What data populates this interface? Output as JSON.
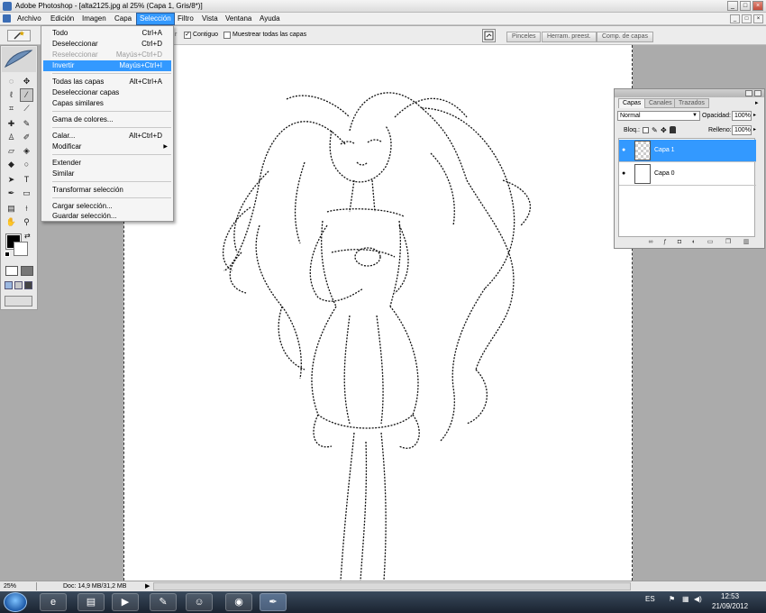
{
  "window": {
    "title": "Adobe Photoshop - [alta2125.jpg al 25% (Capa 1, Gris/8*)]",
    "controls": [
      "_",
      "□",
      "×"
    ]
  },
  "menubar": {
    "items": [
      "Archivo",
      "Edición",
      "Imagen",
      "Capa",
      "Selección",
      "Filtro",
      "Vista",
      "Ventana",
      "Ayuda"
    ],
    "open_item": "Selección"
  },
  "doc_controls": [
    "_",
    "□",
    "×"
  ],
  "options": {
    "tool_letter": "r",
    "contiguous_label": "Contiguo",
    "contiguous_checked": "✓",
    "sample_all_label": "Muestrear todas las capas",
    "palette_tabs": [
      "Pinceles",
      "Herram. preest.",
      "Comp. de capas"
    ]
  },
  "selection_menu": {
    "items": [
      {
        "label": "Todo",
        "shortcut": "Ctrl+A"
      },
      {
        "label": "Deseleccionar",
        "shortcut": "Ctrl+D"
      },
      {
        "label": "Reseleccionar",
        "shortcut": "Mayús+Ctrl+D"
      },
      {
        "label": "Invertir",
        "shortcut": "Mayús+Ctrl+I"
      },
      {
        "label": "Todas las capas",
        "shortcut": "Alt+Ctrl+A"
      },
      {
        "label": "Deseleccionar capas",
        "shortcut": ""
      },
      {
        "label": "Capas similares",
        "shortcut": ""
      },
      {
        "label": "Gama de colores...",
        "shortcut": ""
      },
      {
        "label": "Calar...",
        "shortcut": "Alt+Ctrl+D"
      },
      {
        "label": "Modificar",
        "shortcut": ""
      },
      {
        "label": "Extender",
        "shortcut": ""
      },
      {
        "label": "Similar",
        "shortcut": ""
      },
      {
        "label": "Transformar selección",
        "shortcut": ""
      },
      {
        "label": "Cargar selección...",
        "shortcut": ""
      },
      {
        "label": "Guardar selección...",
        "shortcut": ""
      }
    ],
    "disabled": [
      "Reseleccionar"
    ],
    "highlighted": "Invertir",
    "submenu_arrow": "▶"
  },
  "layers_panel": {
    "tabs": [
      "Capas",
      "Canales",
      "Trazados"
    ],
    "active_tab": "Capas",
    "blend_mode": "Normal",
    "opacity_label": "Opacidad:",
    "opacity_value": "100%",
    "lock_label": "Bloq.:",
    "fill_label": "Relleno:",
    "fill_value": "100%",
    "layers": [
      {
        "name": "Capa 1",
        "selected": true
      },
      {
        "name": "Capa 0",
        "selected": false
      }
    ],
    "eye_glyph": "●",
    "footer_icons": [
      "link-icon",
      "fx-icon",
      "mask-icon",
      "adjustment-icon",
      "group-icon",
      "new-layer-icon",
      "trash-icon"
    ]
  },
  "status": {
    "zoom": "25%",
    "doc_info": "Doc: 14,9 MB/31,2 MB",
    "arrow": "▶"
  },
  "taskbar": {
    "language": "ES",
    "time": "12:53",
    "date": "21/09/2012",
    "apps": [
      "ie-icon",
      "explorer-icon",
      "media-player-icon",
      "paint-icon",
      "messenger-icon",
      "chrome-icon",
      "photoshop-feather-icon"
    ]
  },
  "colors": {
    "highlight": "#3399ff",
    "foreground": "#000000",
    "background": "#ffffff"
  }
}
